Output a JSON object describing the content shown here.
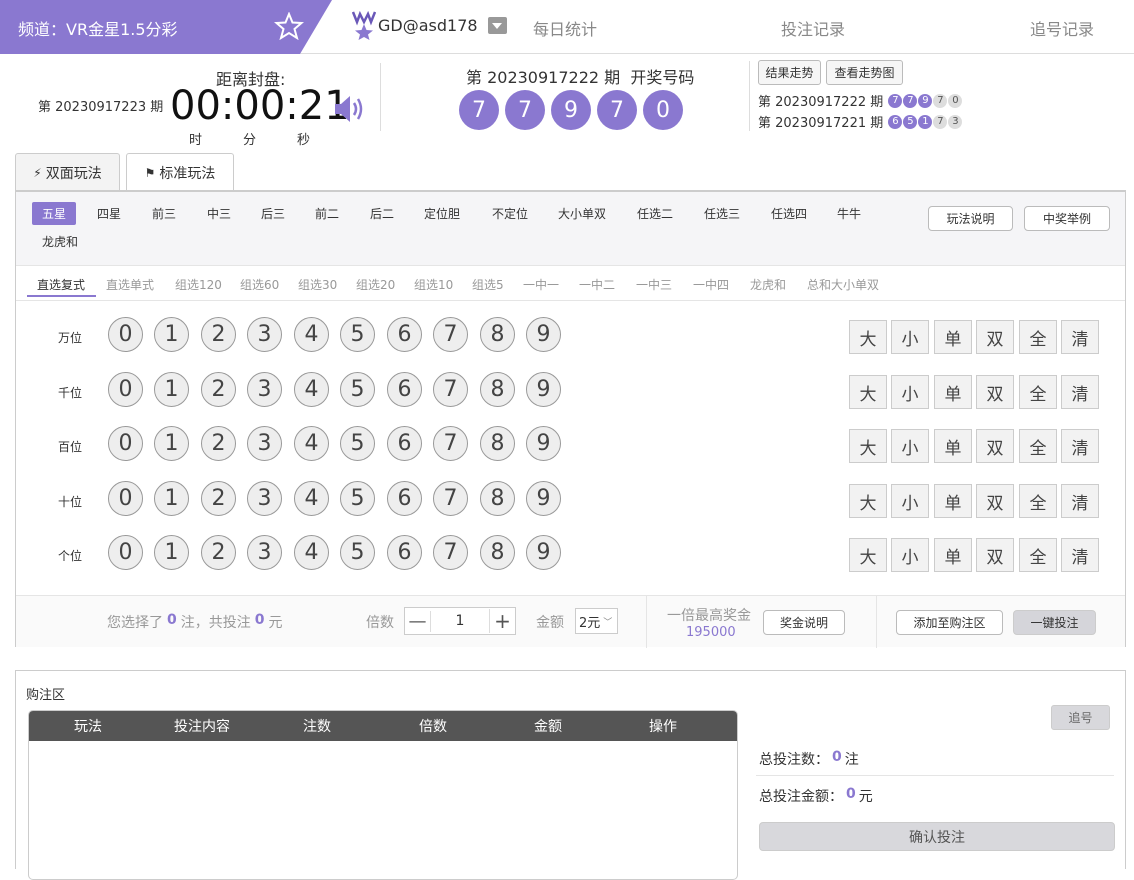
{
  "header": {
    "channel": "频道：VR金星1.5分彩",
    "user": "GD@asd178",
    "nav": [
      "每日统计",
      "投注记录",
      "追号记录"
    ]
  },
  "countdown": {
    "title": "距离封盘:",
    "period": "第 20230917223 期",
    "time": "00:00:21",
    "units": [
      "时",
      "分",
      "秒"
    ]
  },
  "draw": {
    "title": "第 20230917222 期  开奖号码",
    "numbers": [
      "7",
      "7",
      "9",
      "7",
      "0"
    ]
  },
  "history": {
    "buttons": [
      "结果走势",
      "查看走势图"
    ],
    "rows": [
      {
        "period": "第 20230917222 期",
        "nums": [
          "7",
          "7",
          "9",
          "7",
          "0"
        ]
      },
      {
        "period": "第 20230917221 期",
        "nums": [
          "6",
          "5",
          "1",
          "7",
          "3"
        ]
      }
    ]
  },
  "tabs": [
    "双面玩法",
    "标准玩法"
  ],
  "mode_tabs": [
    "五星",
    "四星",
    "前三",
    "中三",
    "后三",
    "前二",
    "后二",
    "定位胆",
    "不定位",
    "大小单双",
    "任选二",
    "任选三",
    "任选四",
    "牛牛",
    "龙虎和"
  ],
  "help_buttons": [
    "玩法说明",
    "中奖举例"
  ],
  "sub_tabs": [
    "直选复式",
    "直选单式",
    "组选120",
    "组选60",
    "组选30",
    "组选20",
    "组选10",
    "组选5",
    "一中一",
    "一中二",
    "一中三",
    "一中四",
    "龙虎和",
    "总和大小单双"
  ],
  "positions": [
    "万位",
    "千位",
    "百位",
    "十位",
    "个位"
  ],
  "digits": [
    "0",
    "1",
    "2",
    "3",
    "4",
    "5",
    "6",
    "7",
    "8",
    "9"
  ],
  "quick": [
    "大",
    "小",
    "单",
    "双",
    "全",
    "清"
  ],
  "summary": {
    "pre": "您选择了",
    "count": "0",
    "mid": "注，共投注",
    "amount": "0",
    "post": "元",
    "multiple_label": "倍数",
    "multiple": "1",
    "money_label": "金额",
    "money": "2元",
    "prize_label": "一倍最高奖金",
    "prize": "195000",
    "prize_btn": "奖金说明",
    "add_btn": "添加至购注区",
    "quick_btn": "一键投注"
  },
  "cart": {
    "title": "购注区",
    "columns": [
      "玩法",
      "投注内容",
      "注数",
      "倍数",
      "金额",
      "操作"
    ],
    "chase_btn": "追号",
    "total_count_label": "总投注数：",
    "total_count": "0",
    "total_count_unit": "注",
    "total_amount_label": "总投注金额：",
    "total_amount": "0",
    "total_amount_unit": "元",
    "confirm_btn": "确认投注"
  },
  "colors": {
    "accent": "#8a78d0"
  }
}
